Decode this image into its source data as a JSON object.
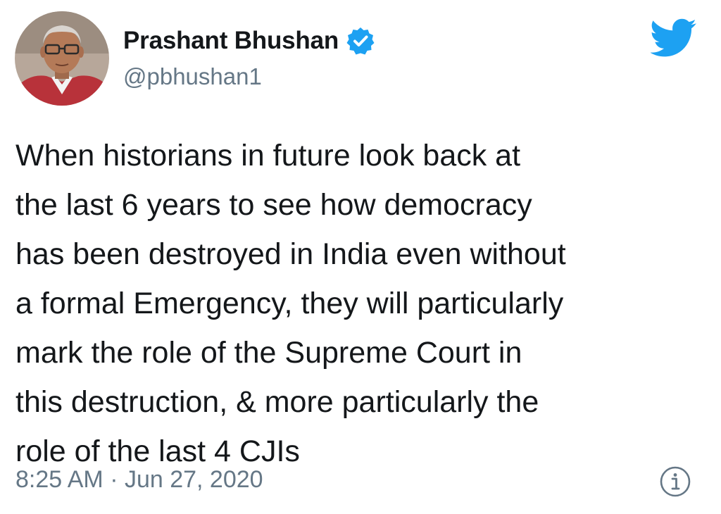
{
  "tweet": {
    "display_name": "Prashant Bhushan",
    "handle": "@pbhushan1",
    "verified": true,
    "lines": [
      "When historians in future look back at",
      "the last 6 years to see how democracy",
      "has been destroyed in India even without",
      "a formal Emergency, they will particularly",
      "mark the role of the Supreme Court in",
      "this destruction, & more particularly the",
      "role of the last 4 CJIs"
    ],
    "timestamp": "8:25 AM · Jun 27, 2020"
  },
  "icons": {
    "avatar": "profile-photo",
    "verified": "verified-badge-icon",
    "brand": "twitter-bird-icon",
    "info": "info-icon"
  },
  "colors": {
    "brand_blue": "#1da1f2",
    "text": "#14171a",
    "secondary_text": "#657786",
    "background": "#ffffff"
  }
}
